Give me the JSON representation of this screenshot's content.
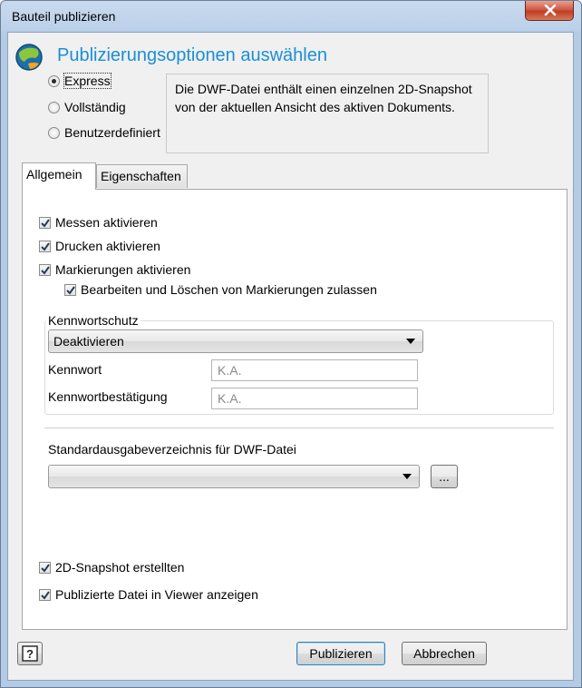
{
  "window": {
    "title": "Bauteil publizieren"
  },
  "header": {
    "title": "Publizierungsoptionen auswählen"
  },
  "publish_mode": {
    "options": [
      {
        "label": "Express",
        "selected": true
      },
      {
        "label": "Vollständig",
        "selected": false
      },
      {
        "label": "Benutzerdefiniert",
        "selected": false
      }
    ],
    "description": "Die DWF-Datei enthält einen einzelnen 2D-Snapshot von der aktuellen Ansicht des aktiven Dokuments."
  },
  "tabs": [
    {
      "label": "Allgemein",
      "active": true
    },
    {
      "label": "Eigenschaften",
      "active": false
    }
  ],
  "general": {
    "checks": [
      {
        "label": "Messen aktivieren",
        "checked": true
      },
      {
        "label": "Drucken aktivieren",
        "checked": true
      },
      {
        "label": "Markierungen aktivieren",
        "checked": true
      },
      {
        "label": "Bearbeiten und Löschen von Markierungen zulassen",
        "checked": true
      }
    ],
    "password_group": {
      "title": "Kennwortschutz",
      "mode": "Deaktivieren",
      "password_label": "Kennwort",
      "password_value": "K.A.",
      "confirm_label": "Kennwortbestätigung",
      "confirm_value": "K.A."
    },
    "output_dir": {
      "label": "Standardausgabeverzeichnis für DWF-Datei",
      "value": "",
      "browse_label": "..."
    },
    "bottom_checks": [
      {
        "label": "2D-Snapshot erstellten",
        "checked": true
      },
      {
        "label": "Publizierte Datei in Viewer anzeigen",
        "checked": true
      }
    ]
  },
  "footer": {
    "help_label": "?",
    "publish_label": "Publizieren",
    "cancel_label": "Abbrechen"
  },
  "colors": {
    "heading": "#1a8fd6",
    "close": "#c13b25"
  },
  "icons": [
    "app-globe-icon",
    "close-icon",
    "help-icon",
    "checkmark-icon",
    "dropdown-arrow-icon"
  ]
}
